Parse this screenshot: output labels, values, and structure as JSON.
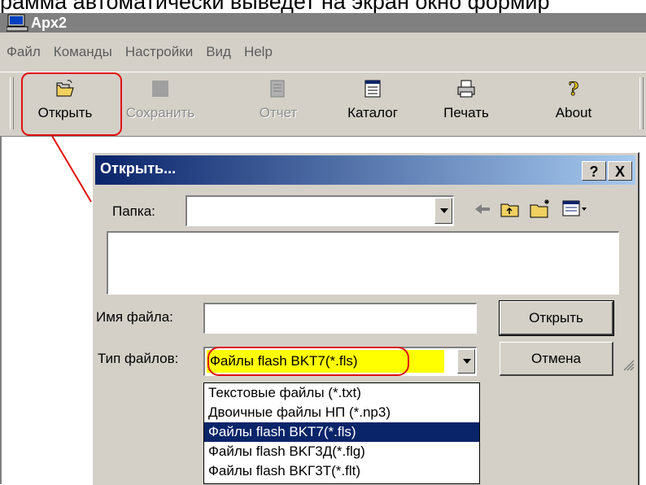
{
  "caption": "рамма автоматически выведет на экран окно формир",
  "window": {
    "title": "Apx2"
  },
  "menu": [
    "Файл",
    "Команды",
    "Настройки",
    "Вид",
    "Help"
  ],
  "toolbar": [
    {
      "label": "Открыть",
      "icon": "open-folder-icon",
      "enabled": true
    },
    {
      "label": "Сохранить",
      "icon": "save-icon",
      "enabled": false
    },
    {
      "label": "Отчет",
      "icon": "report-icon",
      "enabled": false
    },
    {
      "label": "Каталог",
      "icon": "catalog-icon",
      "enabled": true
    },
    {
      "label": "Печать",
      "icon": "printer-icon",
      "enabled": true
    },
    {
      "label": "About",
      "icon": "help-icon",
      "enabled": true
    }
  ],
  "dialog": {
    "title": "Открыть...",
    "help_btn": "?",
    "close_btn": "X",
    "folder_label": "Папка:",
    "folder_value": "",
    "filename_label": "Имя файла:",
    "filename_value": "",
    "filetype_label": "Тип файлов:",
    "filetype_value": "Файлы flash BKT7(*.fls)",
    "open_btn": "Открыть",
    "cancel_btn": "Отмена"
  },
  "filetype_options": [
    "Текстовые файлы (*.txt)",
    "Двоичные файлы НП (*.np3)",
    "Файлы flash BKT7(*.fls)",
    "Файлы flash BKГ3Д(*.flg)",
    "Файлы flash BKГ3T(*.flt)"
  ],
  "selected_option_index": 2,
  "colors": {
    "highlight_annotation": "#e01010",
    "filetype_highlight": "#ffff00",
    "selection": "#0a246a",
    "title_gradient_start": "#0a246a"
  }
}
